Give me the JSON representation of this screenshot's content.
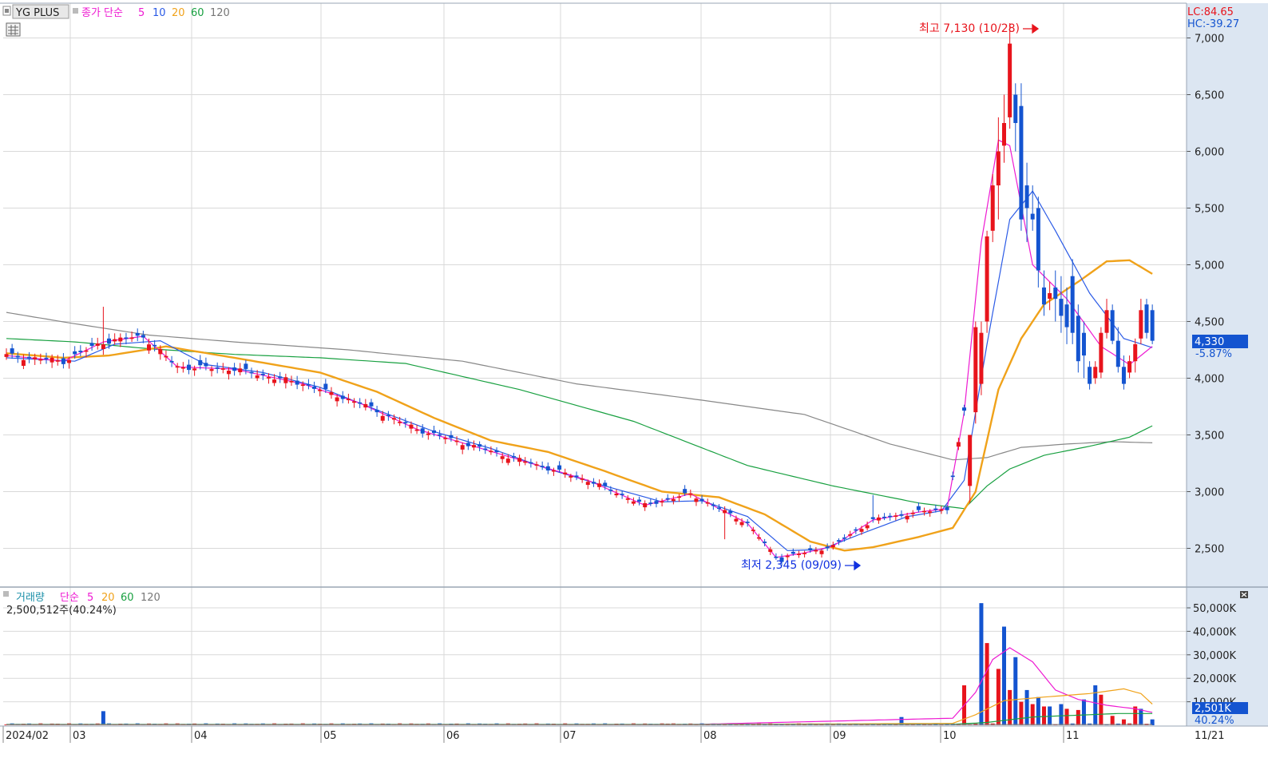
{
  "header": {
    "stock_name": "YG PLUS",
    "ma_label": "종가 단순",
    "ma_periods": [
      "5",
      "10",
      "20",
      "60",
      "120"
    ],
    "lc": "LC:84.65",
    "hc": "HC:-39.27"
  },
  "volume_header": {
    "label": "거래량",
    "ma_label": "단순",
    "ma_periods": [
      "5",
      "20",
      "60",
      "120"
    ],
    "current": "2,500,512주(40.24%)"
  },
  "annotations": {
    "high": "최고 7,130 (10/28)",
    "low": "최저 2,345 (09/09)"
  },
  "current_price": {
    "price": "4,330",
    "change": "-5.87%",
    "volume": "2,501K",
    "volume_pct": "40.24%"
  },
  "colors": {
    "up": "#e8141c",
    "down": "#1454d0",
    "ma5": "#ee1ad2",
    "ma10": "#2a5ae6",
    "ma20": "#f0a21a",
    "ma60": "#18a040",
    "ma120": "#888888",
    "axis_bg": "#dce6f2"
  },
  "chart_data": [
    {
      "type": "candlestick",
      "y_ticks": [
        "7,000",
        "6,500",
        "6,000",
        "5,500",
        "5,000",
        "4,500",
        "4,000",
        "3,500",
        "3,000",
        "2,500"
      ],
      "ylim": [
        2200,
        7250
      ],
      "x_labels": [
        "2024/02",
        "03",
        "04",
        "05",
        "06",
        "07",
        "08",
        "09",
        "10",
        "11",
        "11/21"
      ],
      "series": [
        {
          "name": "종가 단순 5",
          "anchors": [
            [
              0,
              4200
            ],
            [
              10,
              4150
            ],
            [
              17,
              4320
            ],
            [
              24,
              4370
            ],
            [
              30,
              4100
            ],
            [
              40,
              4080
            ],
            [
              52,
              3950
            ],
            [
              62,
              3780
            ],
            [
              72,
              3550
            ],
            [
              82,
              3400
            ],
            [
              92,
              3250
            ],
            [
              102,
              3100
            ],
            [
              112,
              2880
            ],
            [
              120,
              2980
            ],
            [
              130,
              2720
            ],
            [
              135,
              2420
            ],
            [
              140,
              2460
            ],
            [
              145,
              2520
            ],
            [
              152,
              2750
            ],
            [
              160,
              2820
            ],
            [
              165,
              2850
            ],
            [
              168,
              3700
            ],
            [
              171,
              5200
            ],
            [
              174,
              6100
            ],
            [
              176,
              6050
            ],
            [
              180,
              5000
            ],
            [
              186,
              4700
            ],
            [
              192,
              4280
            ],
            [
              197,
              4120
            ],
            [
              201,
              4280
            ]
          ]
        },
        {
          "name": "종가 단순 10",
          "anchors": [
            [
              0,
              4180
            ],
            [
              12,
              4150
            ],
            [
              19,
              4300
            ],
            [
              27,
              4330
            ],
            [
              35,
              4120
            ],
            [
              45,
              4050
            ],
            [
              55,
              3920
            ],
            [
              65,
              3720
            ],
            [
              75,
              3530
            ],
            [
              85,
              3380
            ],
            [
              95,
              3200
            ],
            [
              105,
              3050
            ],
            [
              115,
              2910
            ],
            [
              122,
              2920
            ],
            [
              130,
              2780
            ],
            [
              137,
              2480
            ],
            [
              143,
              2490
            ],
            [
              150,
              2630
            ],
            [
              158,
              2780
            ],
            [
              164,
              2830
            ],
            [
              168,
              3100
            ],
            [
              172,
              4300
            ],
            [
              176,
              5400
            ],
            [
              180,
              5650
            ],
            [
              184,
              5300
            ],
            [
              190,
              4750
            ],
            [
              196,
              4350
            ],
            [
              201,
              4270
            ]
          ]
        },
        {
          "name": "종가 단순 20",
          "anchors": [
            [
              0,
              4220
            ],
            [
              10,
              4180
            ],
            [
              18,
              4200
            ],
            [
              28,
              4280
            ],
            [
              40,
              4180
            ],
            [
              55,
              4050
            ],
            [
              65,
              3880
            ],
            [
              75,
              3650
            ],
            [
              85,
              3450
            ],
            [
              95,
              3350
            ],
            [
              105,
              3180
            ],
            [
              115,
              3000
            ],
            [
              125,
              2950
            ],
            [
              133,
              2800
            ],
            [
              141,
              2560
            ],
            [
              147,
              2480
            ],
            [
              152,
              2510
            ],
            [
              160,
              2600
            ],
            [
              166,
              2680
            ],
            [
              170,
              3000
            ],
            [
              174,
              3900
            ],
            [
              178,
              4350
            ],
            [
              182,
              4650
            ],
            [
              188,
              4850
            ],
            [
              193,
              5030
            ],
            [
              197,
              5040
            ],
            [
              201,
              4920
            ]
          ]
        },
        {
          "name": "종가 단순 60",
          "anchors": [
            [
              0,
              4350
            ],
            [
              12,
              4320
            ],
            [
              25,
              4260
            ],
            [
              40,
              4210
            ],
            [
              55,
              4180
            ],
            [
              70,
              4130
            ],
            [
              90,
              3900
            ],
            [
              110,
              3620
            ],
            [
              130,
              3230
            ],
            [
              145,
              3050
            ],
            [
              160,
              2900
            ],
            [
              168,
              2850
            ],
            [
              172,
              3050
            ],
            [
              176,
              3200
            ],
            [
              182,
              3320
            ],
            [
              190,
              3400
            ],
            [
              197,
              3480
            ],
            [
              201,
              3580
            ]
          ]
        },
        {
          "name": "종가 단순 120",
          "anchors": [
            [
              0,
              4580
            ],
            [
              12,
              4480
            ],
            [
              25,
              4380
            ],
            [
              40,
              4320
            ],
            [
              60,
              4250
            ],
            [
              80,
              4150
            ],
            [
              100,
              3950
            ],
            [
              120,
              3820
            ],
            [
              140,
              3680
            ],
            [
              155,
              3420
            ],
            [
              166,
              3280
            ],
            [
              172,
              3300
            ],
            [
              178,
              3390
            ],
            [
              186,
              3420
            ],
            [
              194,
              3440
            ],
            [
              201,
              3430
            ]
          ]
        }
      ]
    },
    {
      "type": "bar",
      "y_ticks": [
        "50,000K",
        "40,000K",
        "30,000K",
        "20,000K",
        "10,000K"
      ],
      "ylim": [
        0,
        55000
      ],
      "spikes": [
        [
          17,
          6000
        ],
        [
          116,
          700
        ],
        [
          157,
          3500
        ],
        [
          168,
          17000
        ],
        [
          171,
          52000
        ],
        [
          172,
          35000
        ],
        [
          174,
          24000
        ],
        [
          175,
          42000
        ],
        [
          176,
          15000
        ],
        [
          177,
          29000
        ],
        [
          178,
          10000
        ],
        [
          179,
          15000
        ],
        [
          180,
          9000
        ],
        [
          181,
          12000
        ],
        [
          182,
          8000
        ],
        [
          183,
          8000
        ],
        [
          185,
          9000
        ],
        [
          186,
          7000
        ],
        [
          188,
          6500
        ],
        [
          189,
          11000
        ],
        [
          191,
          17000
        ],
        [
          192,
          13000
        ],
        [
          194,
          4000
        ],
        [
          196,
          2500
        ],
        [
          198,
          8000
        ],
        [
          199,
          7000
        ],
        [
          201,
          2500
        ]
      ],
      "series": [
        {
          "name": "단순 5",
          "anchors": [
            [
              0,
              300
            ],
            [
              120,
              300
            ],
            [
              166,
              3000
            ],
            [
              170,
              14000
            ],
            [
              173,
              28000
            ],
            [
              176,
              33000
            ],
            [
              180,
              27000
            ],
            [
              184,
              15000
            ],
            [
              188,
              11000
            ],
            [
              193,
              8500
            ],
            [
              198,
              7000
            ],
            [
              201,
              5500
            ]
          ]
        },
        {
          "name": "20",
          "anchors": [
            [
              0,
              300
            ],
            [
              120,
              300
            ],
            [
              166,
              800
            ],
            [
              170,
              4500
            ],
            [
              175,
              10500
            ],
            [
              182,
              12000
            ],
            [
              190,
              13500
            ],
            [
              196,
              15500
            ],
            [
              199,
              13500
            ],
            [
              201,
              9000
            ]
          ]
        },
        {
          "name": "60",
          "anchors": [
            [
              0,
              400
            ],
            [
              120,
              400
            ],
            [
              166,
              400
            ],
            [
              172,
              1200
            ],
            [
              180,
              3500
            ],
            [
              195,
              5000
            ],
            [
              201,
              5000
            ]
          ]
        },
        {
          "name": "120",
          "anchors": [
            [
              0,
              300
            ],
            [
              201,
              300
            ]
          ]
        }
      ]
    }
  ]
}
